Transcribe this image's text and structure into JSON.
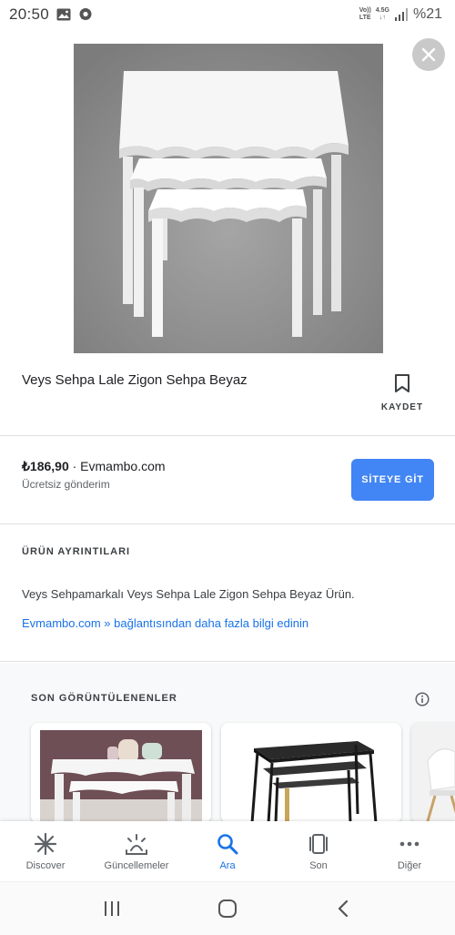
{
  "status_bar": {
    "time": "20:50",
    "volte_top": "Vo))",
    "volte_bottom": "LTE",
    "network_top": "4.5G",
    "network_bottom": "↓↑",
    "battery": "%21"
  },
  "product": {
    "title": "Veys Sehpa Lale Zigon Sehpa Beyaz",
    "save_label": "KAYDET",
    "price": "₺186,90",
    "seller": " · Evmambo.com",
    "shipping": "Ücretsiz gönderim",
    "visit_label": "SİTEYE GİT"
  },
  "details": {
    "heading": "ÜRÜN AYRINTILARI",
    "description": "Veys Sehpamarkalı Veys Sehpa Lale Zigon Sehpa Beyaz Ürün.",
    "link": "Evmambo.com » bağlantısından daha fazla bilgi edinin"
  },
  "recent": {
    "heading": "SON GÖRÜNTÜLENENLER"
  },
  "bottom_nav": [
    {
      "label": "Discover",
      "icon": "asterisk-icon"
    },
    {
      "label": "Güncellemeler",
      "icon": "updates-icon"
    },
    {
      "label": "Ara",
      "icon": "search-icon",
      "active": true
    },
    {
      "label": "Son",
      "icon": "recent-tabs-icon"
    },
    {
      "label": "Diğer",
      "icon": "more-dots-icon"
    }
  ],
  "colors": {
    "accent": "#4285f4",
    "link": "#1a73e8"
  }
}
